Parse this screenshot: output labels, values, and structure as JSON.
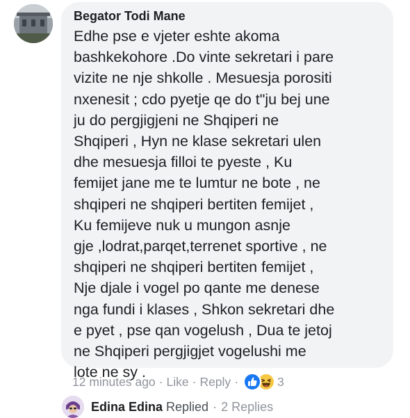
{
  "comment": {
    "author": "Begator Todi Mane",
    "lines": [
      "Edhe pse e vjeter eshte akoma",
      "bashkekohore .Do vinte sekretari i pare",
      "vizite ne nje shkolle . Mesuesja porositi",
      "nxenesit ; cdo pyetje qe do t\"ju bej une",
      "ju do pergjigjeni ne Shqiperi ne",
      "Shqiperi , Hyn ne klase sekretari ulen",
      "dhe mesuesja filloi te pyeste , Ku",
      "femijet jane me te lumtur ne bote , ne",
      "shqiperi ne shqiperi bertiten femijet ,",
      "Ku femijeve nuk u mungon asnje",
      "gje ,lodrat,parqet,terrenet sportive , ne",
      "shqiperi ne shqiperi bertiten femijet ,",
      "Nje djale i vogel po qante me denese",
      "nga fundi i klases , Shkon sekretari dhe",
      "e pyet , pse qan vogelush , Dua te jetoj",
      "ne Shqiperi pergjigjet vogelushi me",
      "lote ne sy ."
    ],
    "timestamp": "12 minutes ago",
    "separator": "·",
    "like_label": "Like",
    "reply_label": "Reply",
    "reaction_count": "3",
    "reactions": [
      "like-icon",
      "haha-icon"
    ]
  },
  "reply_summary": {
    "name": "Edina Edina",
    "verb": "Replied",
    "separator": "·",
    "count_label": "2 Replies"
  },
  "colors": {
    "bubble": "#f2f3f5",
    "meta_text": "#90949c",
    "like_blue": "#1877f2",
    "haha_yellow": "#f7c844"
  }
}
